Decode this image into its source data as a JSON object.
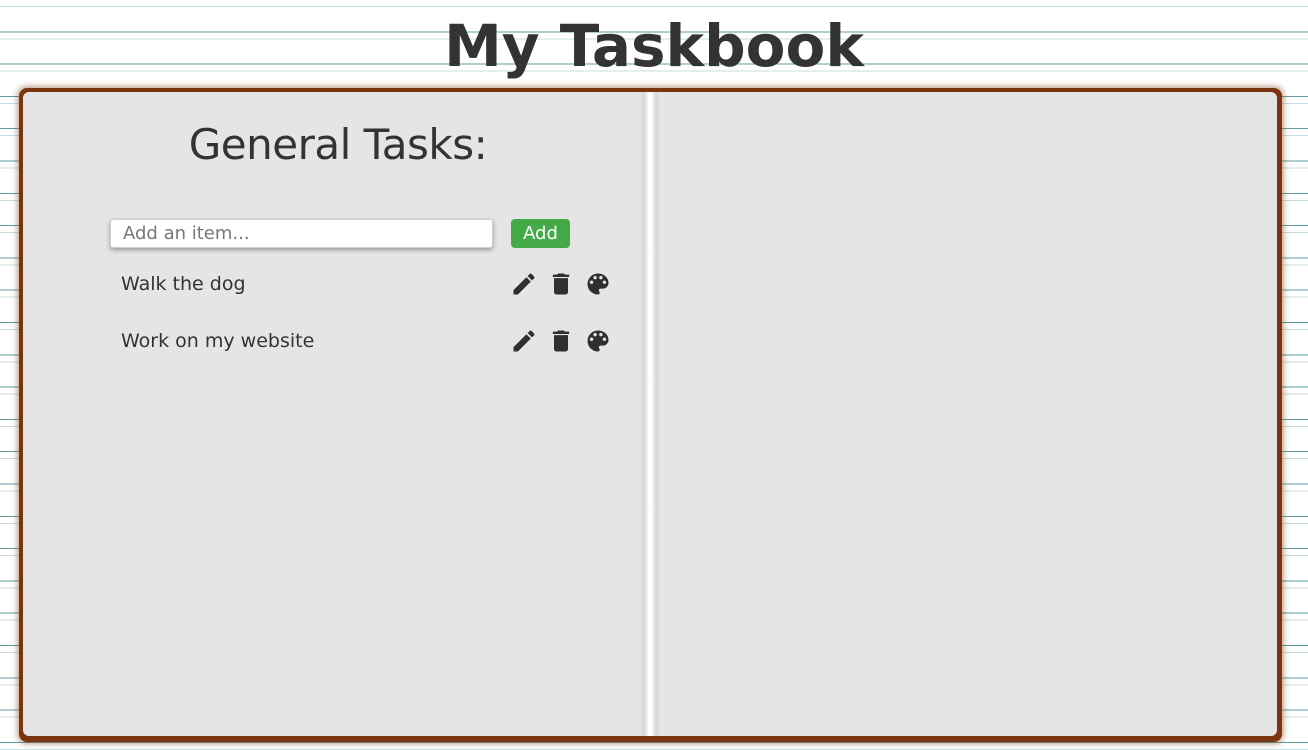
{
  "header": {
    "title": "My Taskbook"
  },
  "left_page": {
    "section_title": "General Tasks:",
    "add_input": {
      "placeholder": "Add an item...",
      "value": ""
    },
    "add_button_label": "Add",
    "tasks": [
      {
        "label": "Walk the dog",
        "actions": [
          "pencil-icon",
          "trash-icon",
          "palette-icon"
        ]
      },
      {
        "label": "Work on my website",
        "actions": [
          "pencil-icon",
          "trash-icon",
          "palette-icon"
        ]
      }
    ]
  },
  "right_page": {},
  "colors": {
    "book_cover": "#7a3510",
    "page": "#e5e5e5",
    "accent_button": "#44aa48",
    "text": "#333333",
    "rule_line": "#5a9d9d"
  }
}
